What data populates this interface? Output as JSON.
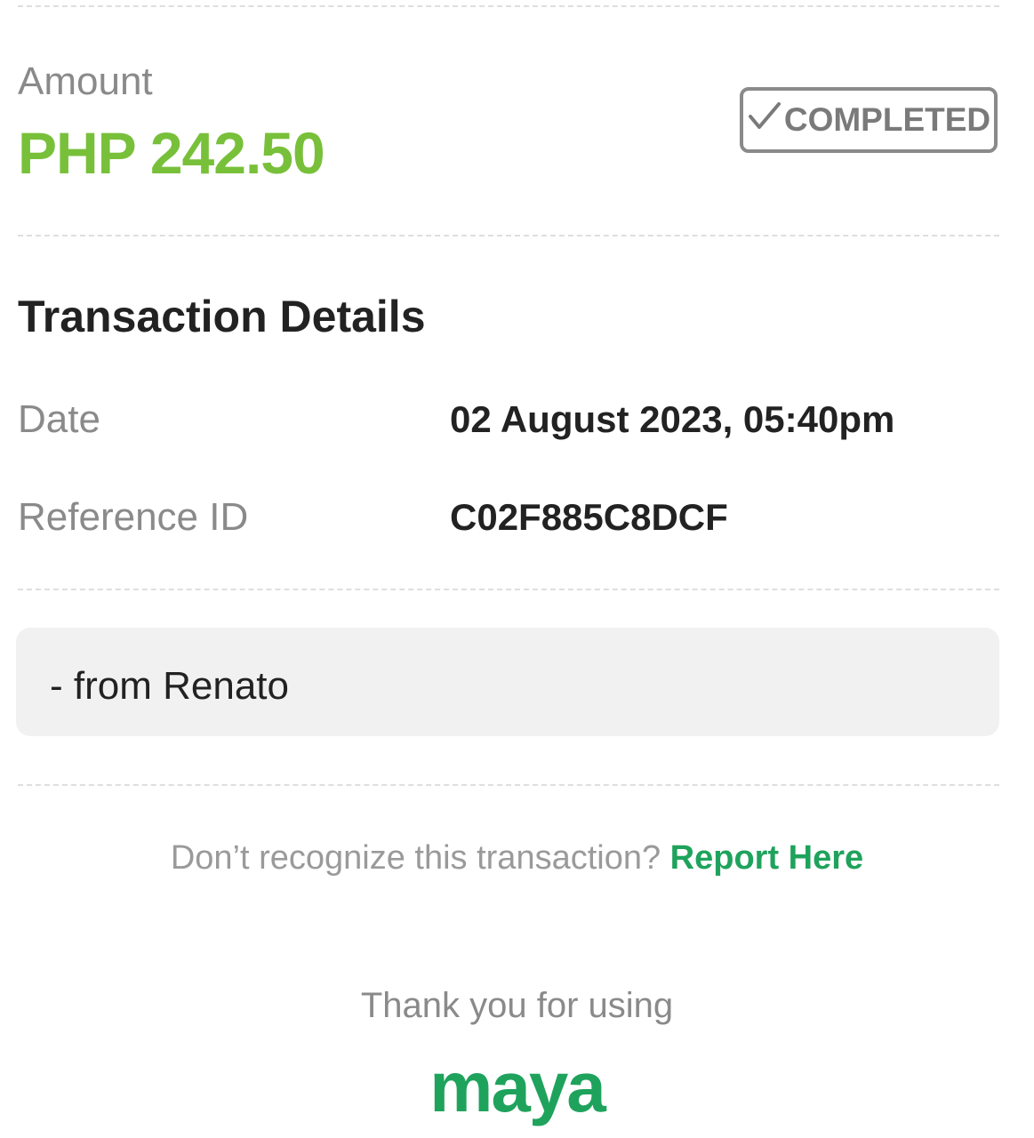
{
  "amount": {
    "label": "Amount",
    "value": "PHP 242.50"
  },
  "status": {
    "label": "COMPLETED",
    "icon": "checkmark-icon"
  },
  "details": {
    "title": "Transaction Details",
    "rows": [
      {
        "label": "Date",
        "value": "02 August 2023, 05:40pm"
      },
      {
        "label": "Reference ID",
        "value": "C02F885C8DCF"
      }
    ]
  },
  "note": {
    "text": "- from Renato"
  },
  "report": {
    "prompt": "Don’t recognize this transaction? ",
    "link_label": "Report Here"
  },
  "footer": {
    "thanks": "Thank you for using",
    "logo": "maya"
  },
  "colors": {
    "amount_green": "#78c03a",
    "brand_green": "#1fa35c",
    "muted_gray": "#8a8a8a",
    "text_dark": "#222222"
  }
}
